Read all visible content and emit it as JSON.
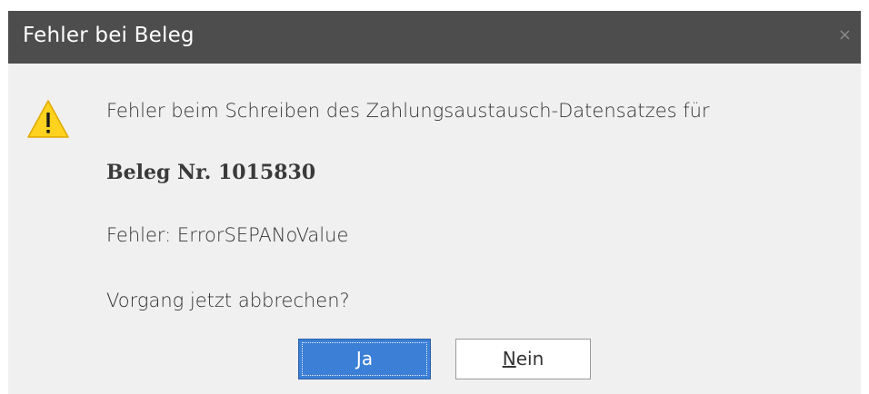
{
  "dialog": {
    "title": "Fehler bei Beleg",
    "close_glyph": "×",
    "icon": "warning-icon",
    "messages": {
      "line1": "Fehler beim Schreiben des Zahlungsaustausch-Datensatzes für",
      "line2": "Beleg Nr. 1015830",
      "line3": "Fehler: ErrorSEPANoValue",
      "line4": "Vorgang jetzt abbrechen?"
    },
    "buttons": {
      "yes_mnemonic": "J",
      "yes_rest": "a",
      "no_mnemonic": "N",
      "no_rest": "ein"
    }
  },
  "colors": {
    "titlebar": "#4d4d4d",
    "body": "#f0f0f0",
    "primary_button": "#3b7fd6",
    "warning": "#ffd21f"
  }
}
